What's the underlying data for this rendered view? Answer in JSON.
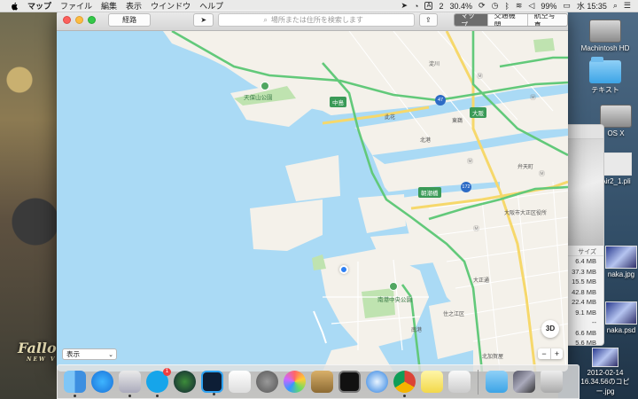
{
  "menubar": {
    "app": "マップ",
    "items": [
      "ファイル",
      "編集",
      "表示",
      "ウインドウ",
      "ヘルプ"
    ],
    "status": {
      "a_badge": "A",
      "notification_count": "2",
      "cpu": "30.4%",
      "battery": "99%",
      "clock": "水 15:35"
    }
  },
  "desktop": {
    "items": [
      {
        "name": "Machintosh HD"
      },
      {
        "name": "テキスト"
      },
      {
        "name": "OS X"
      },
      {
        "name": "Air2_1.pli"
      },
      {
        "name": "naka.jpg"
      },
      {
        "name": "naka.psd"
      },
      {
        "name": "2012-02-14\n16.34.56のコピー.jpg"
      }
    ],
    "wallpaper_text": {
      "title": "Fallo",
      "subtitle": "NEW V"
    }
  },
  "finder": {
    "column_header": "サイズ",
    "sizes": [
      "6.4 MB",
      "37.3 MB",
      "15.5 MB",
      "42.8 MB",
      "22.4 MB",
      "9.1 MB",
      "--",
      "6.6 MB",
      "5.6 MB"
    ]
  },
  "toolbar": {
    "directions_label": "経路",
    "search_placeholder": "場所または住所を検索します",
    "tabs": [
      {
        "label": "マップ",
        "selected": true
      },
      {
        "label": "交通機関",
        "selected": false
      },
      {
        "label": "航空写真",
        "selected": false
      }
    ]
  },
  "map": {
    "pois": [
      "天保山公園",
      "南港中央公園"
    ],
    "road_badges": [
      "中島",
      "朝潮橋"
    ],
    "highway_shields": [
      "47",
      "172"
    ],
    "metro_stations": [
      "大阪"
    ],
    "place_labels": [
      "淀川",
      "此花",
      "北港",
      "弁天町",
      "大阪市大正区役所",
      "大正通",
      "南港",
      "北加賀屋",
      "住之江区",
      "東鵜"
    ],
    "controls": {
      "three_d": "3D",
      "zoom_out": "−",
      "zoom_in": "+",
      "display_label": "表示"
    }
  },
  "dock": {
    "apps": [
      "Finder",
      "App Store",
      "Preview",
      "Skype",
      "Time Machine",
      "Photoshop",
      "TextEdit",
      "System Preferences",
      "Photos",
      "Sketch",
      "Activity Monitor",
      "Safari",
      "Chrome",
      "Notes",
      "Script Editor",
      "Downloads",
      "Photo Stack",
      "Trash"
    ],
    "skype_badge": "1"
  },
  "colors": {
    "map_water": "#aadaf5",
    "map_land": "#f4f1ea",
    "park": "#bfe3b0",
    "main_road": "#62c97a",
    "arterial": "#f6d86b",
    "accent_blue": "#2d7ff3"
  }
}
